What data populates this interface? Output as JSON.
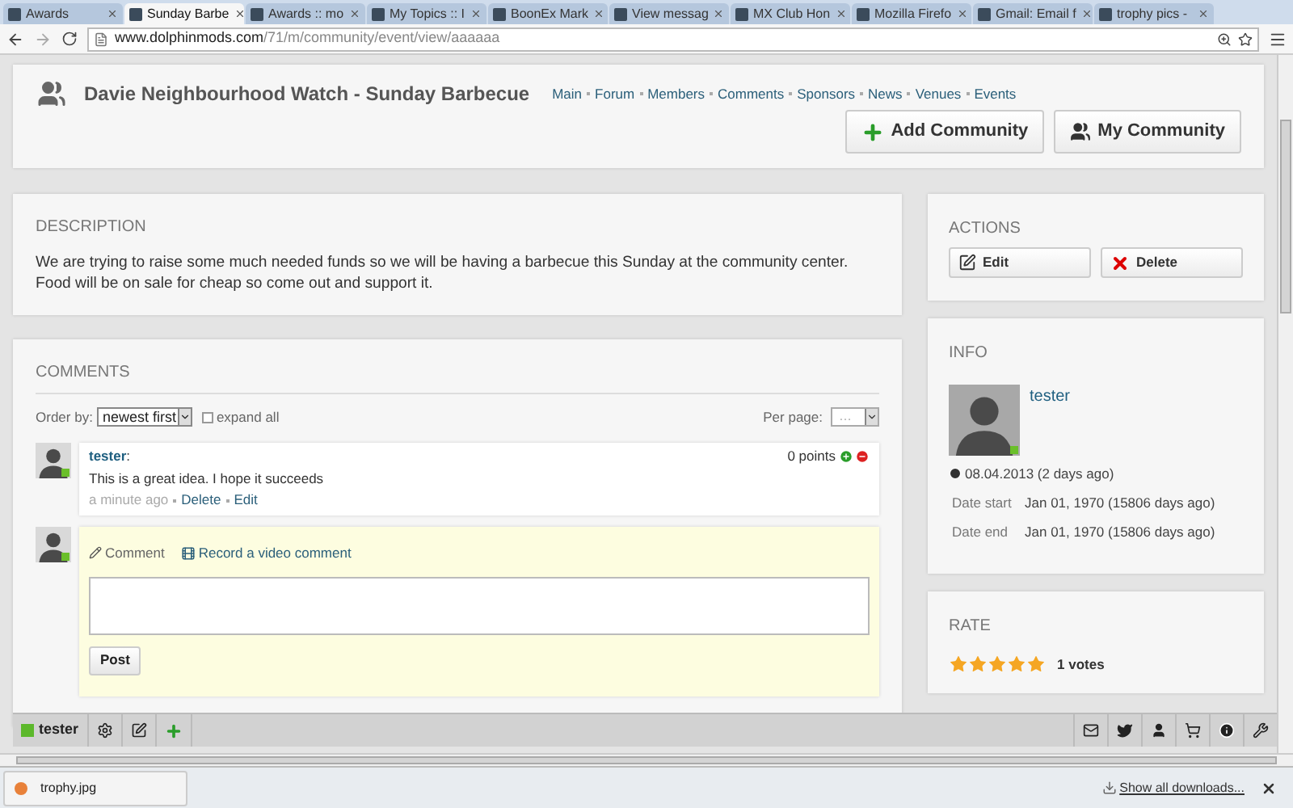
{
  "browser": {
    "tabs": [
      {
        "title": "Awards",
        "selected": false
      },
      {
        "title": "Sunday Barbe",
        "selected": true
      },
      {
        "title": "Awards :: mo",
        "selected": false
      },
      {
        "title": "My Topics :: I",
        "selected": false
      },
      {
        "title": "BoonEx Mark",
        "selected": false
      },
      {
        "title": "View messag",
        "selected": false
      },
      {
        "title": "MX Club Hon",
        "selected": false
      },
      {
        "title": "Mozilla Firefo",
        "selected": false
      },
      {
        "title": "Gmail: Email f",
        "selected": false
      },
      {
        "title": "trophy pics -",
        "selected": false
      }
    ],
    "url_host": "www.dolphinmods.com",
    "url_path": "/71/m/community/event/view/aaaaaa"
  },
  "header": {
    "title": "Davie Neighbourhood Watch - Sunday Barbecue",
    "nav": [
      "Main",
      "Forum",
      "Members",
      "Comments",
      "Sponsors",
      "News",
      "Venues",
      "Events"
    ],
    "buttons": [
      {
        "label": "Add Community",
        "kind": "add"
      },
      {
        "label": "My Community",
        "kind": "community"
      }
    ]
  },
  "description": {
    "heading": "DESCRIPTION",
    "text": "We are trying to raise some much needed funds so we will be having a barbecue this Sunday at the community center. Food will be on sale for cheap so come out and support it."
  },
  "comments": {
    "heading": "COMMENTS",
    "order_label": "Order by:",
    "order_value": "newest first",
    "expand_label": "expand all",
    "expand_checked": false,
    "per_page_label": "Per page:",
    "per_page_value": "…",
    "items": [
      {
        "author": "tester",
        "author_suffix": ":",
        "online": true,
        "text": "This is a great idea. I hope it succeeds",
        "time": "a minute ago",
        "actions": [
          "Delete",
          "Edit"
        ],
        "points": "0 points"
      }
    ],
    "composer": {
      "online": true,
      "tabs": [
        {
          "label": "Comment",
          "kind": "text"
        },
        {
          "label": "Record a video comment",
          "kind": "video"
        }
      ],
      "post": "Post"
    }
  },
  "actions": {
    "heading": "ACTIONS",
    "buttons": [
      {
        "label": "Edit",
        "kind": "edit"
      },
      {
        "label": "Delete",
        "kind": "delete"
      }
    ]
  },
  "info": {
    "heading": "INFO",
    "author": "tester",
    "online": true,
    "created": "08.04.2013 (2 days ago)",
    "rows": [
      {
        "label": "Date start",
        "value": "Jan 01, 1970 (15806 days ago)"
      },
      {
        "label": "Date end",
        "value": "Jan 01, 1970 (15806 days ago)"
      }
    ]
  },
  "rate": {
    "heading": "RATE",
    "stars": 5,
    "votes": "1 votes"
  },
  "toolbar": {
    "user": "tester",
    "online": true
  },
  "downloads": {
    "file": "trophy.jpg",
    "show_all": "Show all downloads..."
  }
}
